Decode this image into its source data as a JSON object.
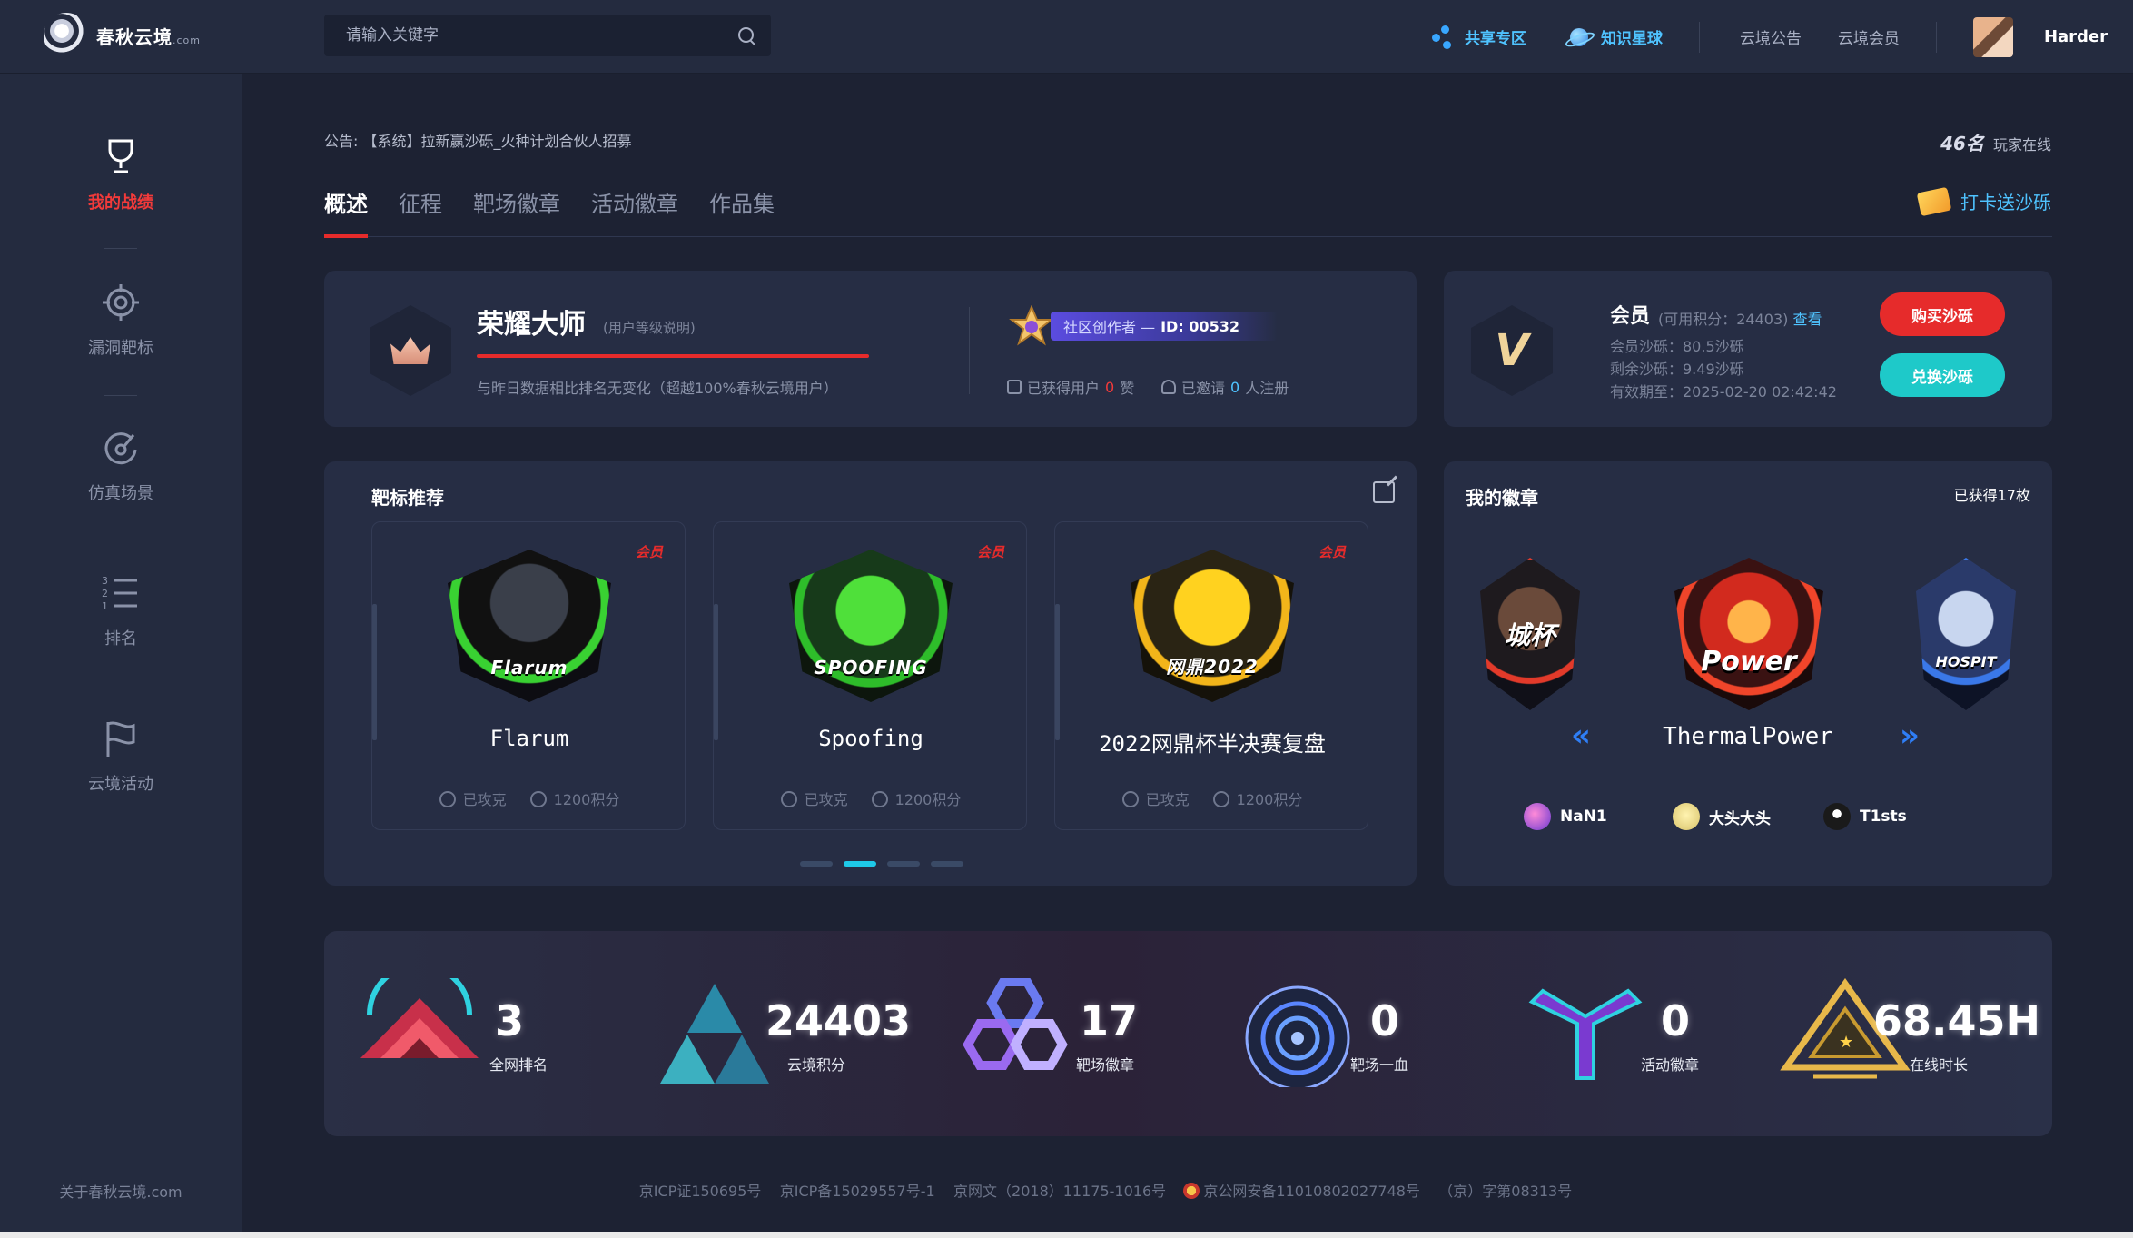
{
  "header": {
    "logo_text": "春秋云境",
    "logo_suffix": ".com",
    "search_placeholder": "请输入关键字",
    "nav": {
      "share": "共享专区",
      "knowledge": "知识星球",
      "notice": "云境公告",
      "member": "云境会员"
    },
    "user_name": "Harder"
  },
  "sidebar": {
    "items": [
      {
        "label": "我的战绩",
        "icon": "trophy-icon",
        "active": true
      },
      {
        "label": "漏洞靶标",
        "icon": "target-icon",
        "active": false
      },
      {
        "label": "仿真场景",
        "icon": "scenario-icon",
        "active": false
      },
      {
        "label": "排名",
        "icon": "ranking-list-icon",
        "active": false
      },
      {
        "label": "云境活动",
        "icon": "flag-icon",
        "active": false
      }
    ],
    "footer": "关于春秋云境.com"
  },
  "notice": {
    "prefix": "公告:",
    "text": "【系统】拉新赢沙砾_火种计划合伙人招募"
  },
  "online": {
    "count": "46名",
    "label": "玩家在线"
  },
  "tabs": [
    "概述",
    "征程",
    "靶场徽章",
    "活动徽章",
    "作品集"
  ],
  "checkin_label": "打卡送沙砾",
  "rank_card": {
    "title": "荣耀大师",
    "note": "(用户等级说明)",
    "desc": "与昨日数据相比排名无变化（超越100%春秋云境用户）",
    "creator_label": "社区创作者 —",
    "creator_id": "ID:  00532",
    "likes_prefix": "已获得用户",
    "likes_count": "0",
    "likes_suffix": "赞",
    "invite_prefix": "已邀请",
    "invite_count": "0",
    "invite_suffix": "人注册"
  },
  "member_card": {
    "title": "会员",
    "points": "(可用积分：24403)",
    "view": "查看",
    "member_sand": "会员沙砾：80.5沙砾",
    "remain_sand": "剩余沙砾：9.49沙砾",
    "expire": "有效期至：2025-02-20 02:42:42",
    "buy": "购买沙砾",
    "exchange": "兑换沙砾"
  },
  "targets": {
    "title": "靶标推荐",
    "items": [
      {
        "name": "Flarum",
        "badge_text": "Flarum",
        "vip": "会员",
        "status": "已攻克",
        "points": "1200积分"
      },
      {
        "name": "Spoofing",
        "badge_text": "SPOOFING",
        "vip": "会员",
        "status": "已攻克",
        "points": "1200积分"
      },
      {
        "name": "2022网鼎杯半决赛复盘",
        "badge_text": "网鼎2022",
        "vip": "会员",
        "status": "已攻克",
        "points": "1200积分"
      }
    ],
    "pages": 4,
    "active_page": 1
  },
  "badges": {
    "title": "我的徽章",
    "count": "已获得17枚",
    "left_text": "城杯",
    "center_text": "Power",
    "right_text": "HOSPIT",
    "center_name": "ThermalPower",
    "owners": [
      "NaN1",
      "大头大头",
      "T1sts"
    ]
  },
  "stats": [
    {
      "value": "3",
      "label": "全网排名"
    },
    {
      "value": "24403",
      "label": "云境积分"
    },
    {
      "value": "17",
      "label": "靶场徽章"
    },
    {
      "value": "0",
      "label": "靶场一血"
    },
    {
      "value": "0",
      "label": "活动徽章"
    },
    {
      "value": "68.45H",
      "label": "在线时长"
    }
  ],
  "footer": {
    "icp1": "京ICP证150695号",
    "icp2": "京ICP备15029557号-1",
    "wen": "京网文（2018）11175-1016号",
    "police": "京公网安备11010802027748号",
    "zi": "（京）字第08313号"
  },
  "colors": {
    "accent_red": "#e62b2b",
    "accent_cyan": "#1ec9c9",
    "link_blue": "#4fc3ff",
    "bg": "#1d2233",
    "panel": "#262d44"
  }
}
